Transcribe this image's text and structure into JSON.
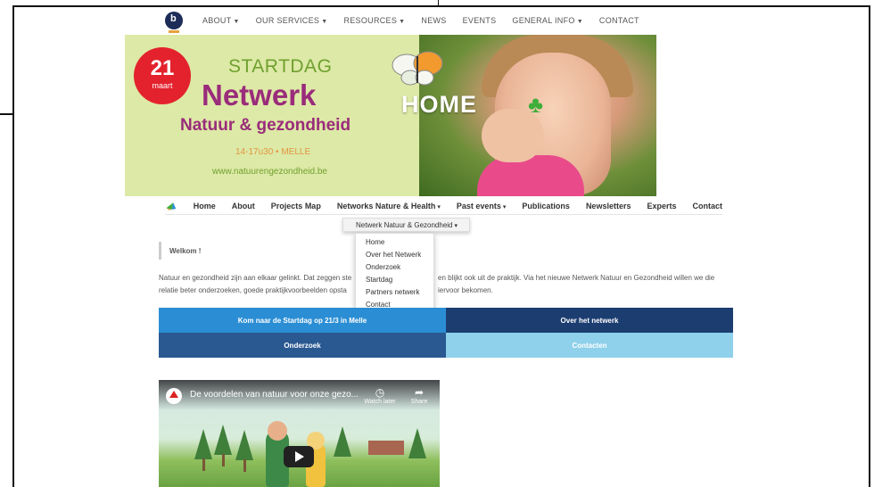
{
  "top_nav": {
    "items": [
      {
        "label": "ABOUT",
        "dropdown": true
      },
      {
        "label": "OUR SERVICES",
        "dropdown": true
      },
      {
        "label": "RESOURCES",
        "dropdown": true
      },
      {
        "label": "NEWS",
        "dropdown": false
      },
      {
        "label": "EVENTS",
        "dropdown": false
      },
      {
        "label": "GENERAL INFO",
        "dropdown": true
      },
      {
        "label": "CONTACT",
        "dropdown": false
      }
    ]
  },
  "hero": {
    "badge_day": "21",
    "badge_month": "maart",
    "startdag": "STARTDAG",
    "netwerk": "Netwerk",
    "subtitle": "Natuur & gezondheid",
    "time_place": "14-17u30 • MELLE",
    "url": "www.natuurengezondheid.be",
    "overlay": "HOME"
  },
  "main_nav": {
    "items": [
      {
        "label": "Home"
      },
      {
        "label": "About"
      },
      {
        "label": "Projects Map"
      },
      {
        "label": "Networks Nature & Health",
        "dropdown": true
      },
      {
        "label": "Past events",
        "dropdown": true
      },
      {
        "label": "Publications"
      },
      {
        "label": "Newsletters"
      },
      {
        "label": "Experts"
      },
      {
        "label": "Contact"
      }
    ]
  },
  "dropdown": {
    "header": "Netwerk Natuur & Gezondheid",
    "items": [
      "Home",
      "Over het Netwerk",
      "Onderzoek",
      "Startdag",
      "Partners netwerk",
      "Contact"
    ]
  },
  "content": {
    "welcome": "Welkom !",
    "intro_line1_a": "Natuur en gezondheid zijn aan elkaar gelinkt. Dat zeggen ste",
    "intro_line1_b": "en blijkt ook uit de praktijk. Via het nieuwe Netwerk Natuur en Gezondheid willen we die",
    "intro_line2_a": "relatie beter onderzoeken, goede praktijkvoorbeelden opsta",
    "intro_line2_b": "iervoor bekomen."
  },
  "tiles": [
    {
      "label": "Kom naar de Startdag op 21/3 in Melle",
      "color": "#2b8ed4"
    },
    {
      "label": "Over het netwerk",
      "color": "#1c3d70"
    },
    {
      "label": "Onderzoek",
      "color": "#2a5891"
    },
    {
      "label": "Contacten",
      "color": "#8fd0ea"
    }
  ],
  "video": {
    "title": "De voordelen van natuur voor onze gezo...",
    "watch_later": "Watch later",
    "share": "Share"
  }
}
